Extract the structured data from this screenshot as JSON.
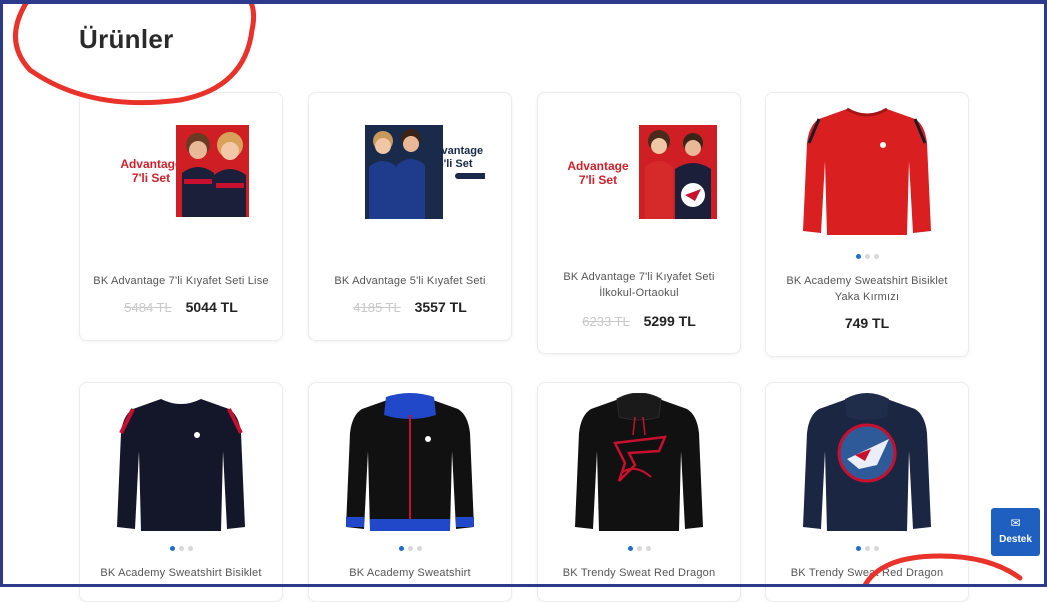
{
  "page": {
    "title": "Ürünler"
  },
  "support_button": {
    "label": "Destek",
    "icon": "envelope-icon"
  },
  "colors": {
    "accent": "#1f5fbf",
    "annotation": "#e8322a",
    "frame": "#2d3a8c"
  },
  "products": [
    {
      "name": "BK Advantage 7'li Kıyafet Seti Lise",
      "old_price": "5484 TL",
      "price": "5044 TL",
      "promo": "Advantage",
      "promo_sub": "7'li Set"
    },
    {
      "name": "BK Advantage 5'li Kıyafet Seti",
      "old_price": "4185 TL",
      "price": "3557 TL",
      "promo": "Advantage",
      "promo_sub": "5'li Set"
    },
    {
      "name": "BK Advantage 7'li Kıyafet Seti İlkokul-Ortaokul",
      "old_price": "6233 TL",
      "price": "5299 TL",
      "promo": "Advantage",
      "promo_sub": "7'li Set"
    },
    {
      "name": "BK Academy Sweatshirt Bisiklet Yaka Kırmızı",
      "old_price": "",
      "price": "749 TL"
    },
    {
      "name": "BK Academy Sweatshirt Bisiklet"
    },
    {
      "name": "BK Academy Sweatshirt"
    },
    {
      "name": "BK Trendy Sweat Red Dragon"
    },
    {
      "name": "BK Trendy Sweat Red Dragon"
    }
  ]
}
